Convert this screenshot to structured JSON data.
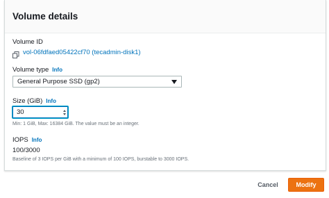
{
  "panel": {
    "title": "Volume details"
  },
  "volume_id": {
    "label": "Volume ID",
    "value": "vol-06fdfaed05422cf70 (tecadmin-disk1)"
  },
  "volume_type": {
    "label": "Volume type",
    "info": "Info",
    "selected": "General Purpose SSD (gp2)"
  },
  "size": {
    "label": "Size (GiB)",
    "info": "Info",
    "value": "30",
    "hint": "Min: 1 GiB, Max: 16384 GiB. The value must be an integer."
  },
  "iops": {
    "label": "IOPS",
    "info": "Info",
    "value": "100/3000",
    "hint": "Baseline of 3 IOPS per GiB with a minimum of 100 IOPS, burstable to 3000 IOPS."
  },
  "actions": {
    "cancel": "Cancel",
    "modify": "Modify"
  },
  "colors": {
    "link": "#0073bb",
    "primary": "#ec7211",
    "focus": "#00a1c9"
  },
  "icons": {
    "copy": "copy-icon",
    "dropdown": "caret-down-icon"
  }
}
